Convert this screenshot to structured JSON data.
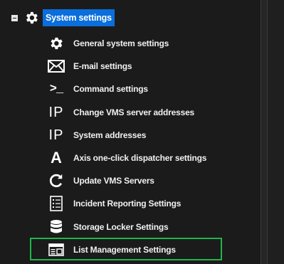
{
  "tree": {
    "root": {
      "label": "System settings",
      "icon": "gear-icon",
      "expanded": true
    },
    "items": [
      {
        "label": "General system settings",
        "icon": "gear-icon"
      },
      {
        "label": "E-mail settings",
        "icon": "envelope-icon"
      },
      {
        "label": "Command settings",
        "icon": "terminal-prompt-icon"
      },
      {
        "label": "Change VMS server addresses",
        "icon": "ip-icon"
      },
      {
        "label": "System addresses",
        "icon": "ip-icon"
      },
      {
        "label": "Axis one-click dispatcher settings",
        "icon": "axis-a-icon"
      },
      {
        "label": "Update VMS Servers",
        "icon": "refresh-icon"
      },
      {
        "label": "Incident Reporting Settings",
        "icon": "report-list-icon"
      },
      {
        "label": "Storage Locker Settings",
        "icon": "database-icon"
      },
      {
        "label": "List Management Settings",
        "icon": "list-window-icon",
        "highlighted": true
      }
    ]
  },
  "colors": {
    "background": "#1b1b1b",
    "selection": "#0a6edc",
    "highlight_border": "#1fb64a",
    "text": "#f0f0f0"
  }
}
